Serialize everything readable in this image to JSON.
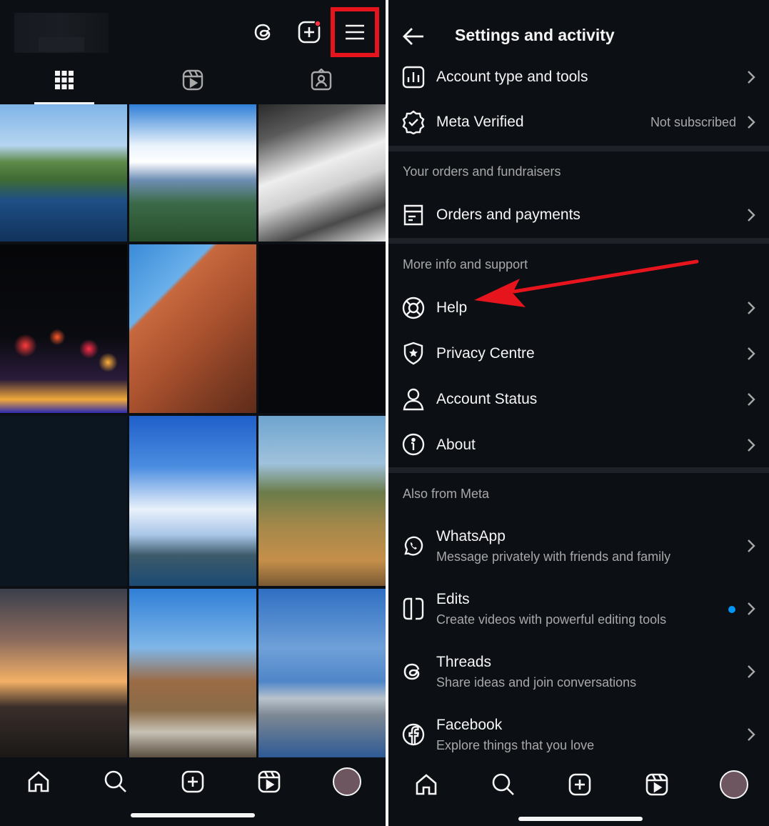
{
  "left": {
    "top_icons": [
      "threads-icon",
      "create-icon",
      "menu-icon"
    ],
    "notification_dot_color": "#ff3040",
    "highlight_color": "#e6141c",
    "tabs": [
      "grid-icon",
      "reels-icon",
      "tagged-icon"
    ],
    "bottom_nav": [
      "home-icon",
      "search-icon",
      "create-icon",
      "reels-icon",
      "profile-avatar"
    ]
  },
  "right": {
    "header": {
      "title": "Settings and activity"
    },
    "items_top": [
      {
        "label": "Account type and tools",
        "icon": "bar-chart-icon"
      },
      {
        "label": "Meta Verified",
        "icon": "verified-badge-icon",
        "status": "Not subscribed"
      }
    ],
    "section_orders": {
      "title": "Your orders and fundraisers",
      "items": [
        {
          "label": "Orders and payments",
          "icon": "receipt-icon"
        }
      ]
    },
    "section_support": {
      "title": "More info and support",
      "items": [
        {
          "label": "Help",
          "icon": "lifebuoy-icon"
        },
        {
          "label": "Privacy Centre",
          "icon": "shield-icon"
        },
        {
          "label": "Account Status",
          "icon": "person-icon"
        },
        {
          "label": "About",
          "icon": "info-icon"
        }
      ]
    },
    "section_meta": {
      "title": "Also from Meta",
      "items": [
        {
          "label": "WhatsApp",
          "sub": "Message privately with friends and family",
          "icon": "whatsapp-icon"
        },
        {
          "label": "Edits",
          "sub": "Create videos with powerful editing tools",
          "icon": "edits-icon",
          "new_badge": true
        },
        {
          "label": "Threads",
          "sub": "Share ideas and join conversations",
          "icon": "threads-icon"
        },
        {
          "label": "Facebook",
          "sub": "Explore things that you love",
          "icon": "facebook-icon"
        }
      ]
    },
    "bottom_nav": [
      "home-icon",
      "search-icon",
      "create-icon",
      "reels-icon",
      "profile-avatar"
    ],
    "annotation_arrow_color": "#e6141c",
    "new_badge_color": "#0095f6"
  }
}
